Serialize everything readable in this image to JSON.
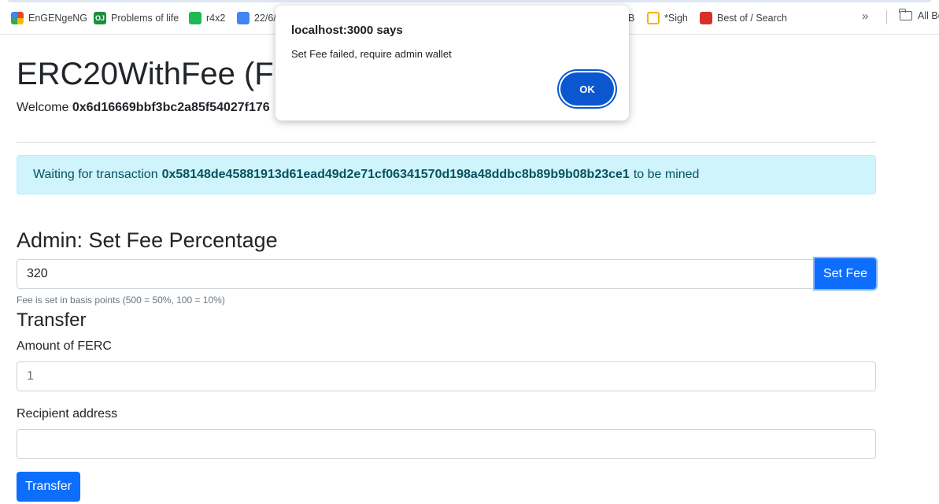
{
  "bookmarks": {
    "items": [
      {
        "label": "EnGENgeNG",
        "icon": "engeng-icon"
      },
      {
        "label": "Problems of life",
        "icon": "oj-icon",
        "badge": "OJ"
      },
      {
        "label": "r4x2",
        "icon": "spotify-icon"
      },
      {
        "label": "22/6/",
        "icon": "doc-icon"
      },
      {
        "label": "B",
        "icon": "bookmark-icon"
      },
      {
        "label": "*Sigh",
        "icon": "sigh-icon"
      },
      {
        "label": "Best of / Search",
        "icon": "best-of-icon"
      }
    ],
    "overflow": "»",
    "all_bookmarks": "All Bo"
  },
  "page": {
    "title": "ERC20WithFee (FE",
    "welcome_prefix": "Welcome",
    "wallet": "0x6d16669bbf3bc2a85f54027f176"
  },
  "alert": {
    "prefix": "Waiting for transaction",
    "tx_hash": "0x58148de45881913d61ead49d2e71cf06341570d198a48ddbc8b89b9b08b23ce1",
    "suffix": "to be mined"
  },
  "admin": {
    "heading": "Admin: Set Fee Percentage",
    "fee_value": "320",
    "button": "Set Fee",
    "hint": "Fee is set in basis points (500 = 50%, 100 = 10%)"
  },
  "transfer": {
    "heading": "Transfer",
    "amount_label": "Amount of FERC",
    "amount_placeholder": "1",
    "recipient_label": "Recipient address",
    "recipient_value": "",
    "button": "Transfer"
  },
  "dialog": {
    "title": "localhost:3000 says",
    "message": "Set Fee failed, require admin wallet",
    "ok": "OK"
  },
  "colors": {
    "primary": "#0d6efd",
    "alert_bg": "#cff4fc",
    "alert_text": "#055160",
    "dialog_ok": "#0b57d0"
  }
}
